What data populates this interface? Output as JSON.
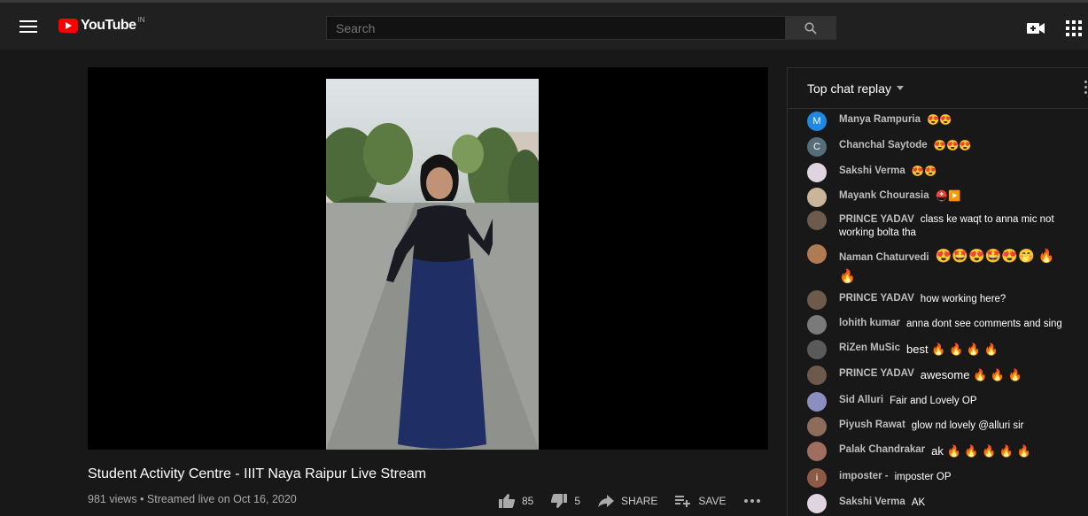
{
  "header": {
    "logo_text": "YouTube",
    "logo_region": "IN",
    "search_placeholder": "Search"
  },
  "video": {
    "title": "Student Activity Centre - IIIT Naya Raipur Live Stream",
    "meta": "981 views • Streamed live on Oct 16, 2020",
    "likes": "85",
    "dislikes": "5",
    "share_label": "SHARE",
    "save_label": "SAVE"
  },
  "chat": {
    "header": "Top chat replay",
    "messages": [
      {
        "author": "Manya Rampuria",
        "text": "😍😍",
        "avatar": "M",
        "avatar_color": "#1e88e5"
      },
      {
        "author": "Chanchal Saytode",
        "text": "😍😍😍",
        "avatar": "C",
        "avatar_color": "#546e7a"
      },
      {
        "author": "Sakshi Verma",
        "text": "😍😍",
        "avatar": "",
        "avatar_color": "#e0d4e0"
      },
      {
        "author": "Mayank Chourasia",
        "text": "⛑️▶️",
        "avatar": "",
        "avatar_color": "#c9b59a"
      },
      {
        "author": "PRINCE YADAV",
        "text": "class ke waqt to anna mic not working bolta tha",
        "avatar": "",
        "avatar_color": "#6d5a4a"
      },
      {
        "author": "Naman Chaturvedi",
        "text": "😍🤩😍🤩😍🤭 🔥 🔥",
        "avatar": "",
        "avatar_color": "#b07a55"
      },
      {
        "author": "PRINCE YADAV",
        "text": "how working here?",
        "avatar": "",
        "avatar_color": "#6d5a4a"
      },
      {
        "author": "lohith kumar",
        "text": "anna dont see comments and sing",
        "avatar": "",
        "avatar_color": "#7a7a7a"
      },
      {
        "author": "RiZen MuSic",
        "text": "best 🔥 🔥 🔥 🔥",
        "avatar": "",
        "avatar_color": "#5a5a5a"
      },
      {
        "author": "PRINCE YADAV",
        "text": "awesome 🔥 🔥 🔥",
        "avatar": "",
        "avatar_color": "#6d5a4a"
      },
      {
        "author": "Sid Alluri",
        "text": "Fair and Lovely OP",
        "avatar": "",
        "avatar_color": "#8a8fc0"
      },
      {
        "author": "Piyush Rawat",
        "text": "glow nd lovely @alluri sir",
        "avatar": "",
        "avatar_color": "#8c6d5c"
      },
      {
        "author": "Palak Chandrakar",
        "text": "ak 🔥 🔥 🔥 🔥 🔥",
        "avatar": "",
        "avatar_color": "#a06e60"
      },
      {
        "author": "imposter -",
        "text": "imposter OP",
        "avatar": "i",
        "avatar_color": "#8d5a45"
      },
      {
        "author": "Sakshi Verma",
        "text": "AK",
        "avatar": "",
        "avatar_color": "#e0d4e0"
      }
    ]
  },
  "colors": {
    "brand_red": "#ff0000",
    "background": "#181818",
    "topbar": "#202020"
  }
}
